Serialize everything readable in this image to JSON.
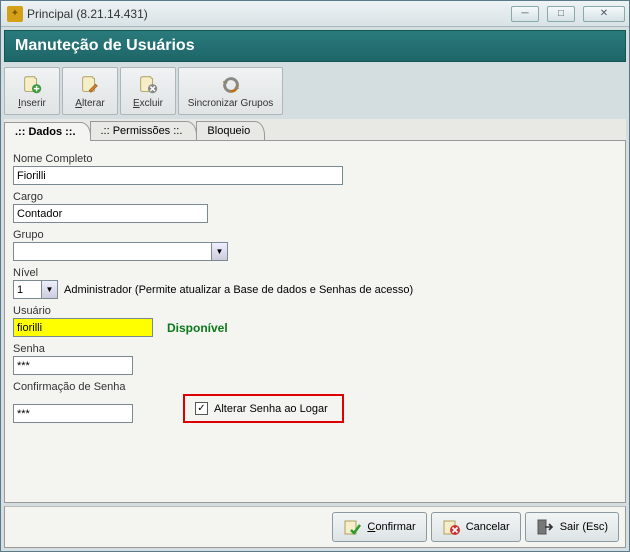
{
  "window": {
    "title": "Principal (8.21.14.431)"
  },
  "section": {
    "title": "Manuteção de Usuários"
  },
  "toolbar": {
    "inserir": "Inserir",
    "alterar": "Alterar",
    "excluir": "Excluir",
    "sync": "Sincronizar Grupos"
  },
  "tabs": {
    "dados": ".:: Dados ::.",
    "permissoes": ".:: Permissões ::.",
    "bloqueio": "Bloqueio"
  },
  "fields": {
    "nome_label": "Nome Completo",
    "nome_value": "Fiorilli",
    "cargo_label": "Cargo",
    "cargo_value": "Contador",
    "grupo_label": "Grupo",
    "grupo_value": "",
    "nivel_label": "Nível",
    "nivel_value": "1",
    "nivel_desc": "Administrador (Permite atualizar a Base de dados e Senhas de acesso)",
    "usuario_label": "Usuário",
    "usuario_value": "fiorilli",
    "disponivel": "Disponível",
    "senha_label": "Senha",
    "senha_value": "***",
    "conf_label": "Confirmação de Senha",
    "conf_value": "***",
    "alterar_checkbox_label": "Alterar Senha ao Logar",
    "alterar_checked": "✓"
  },
  "footer": {
    "confirmar": "Confirmar",
    "cancelar": "Cancelar",
    "sair": "Sair (Esc)"
  }
}
